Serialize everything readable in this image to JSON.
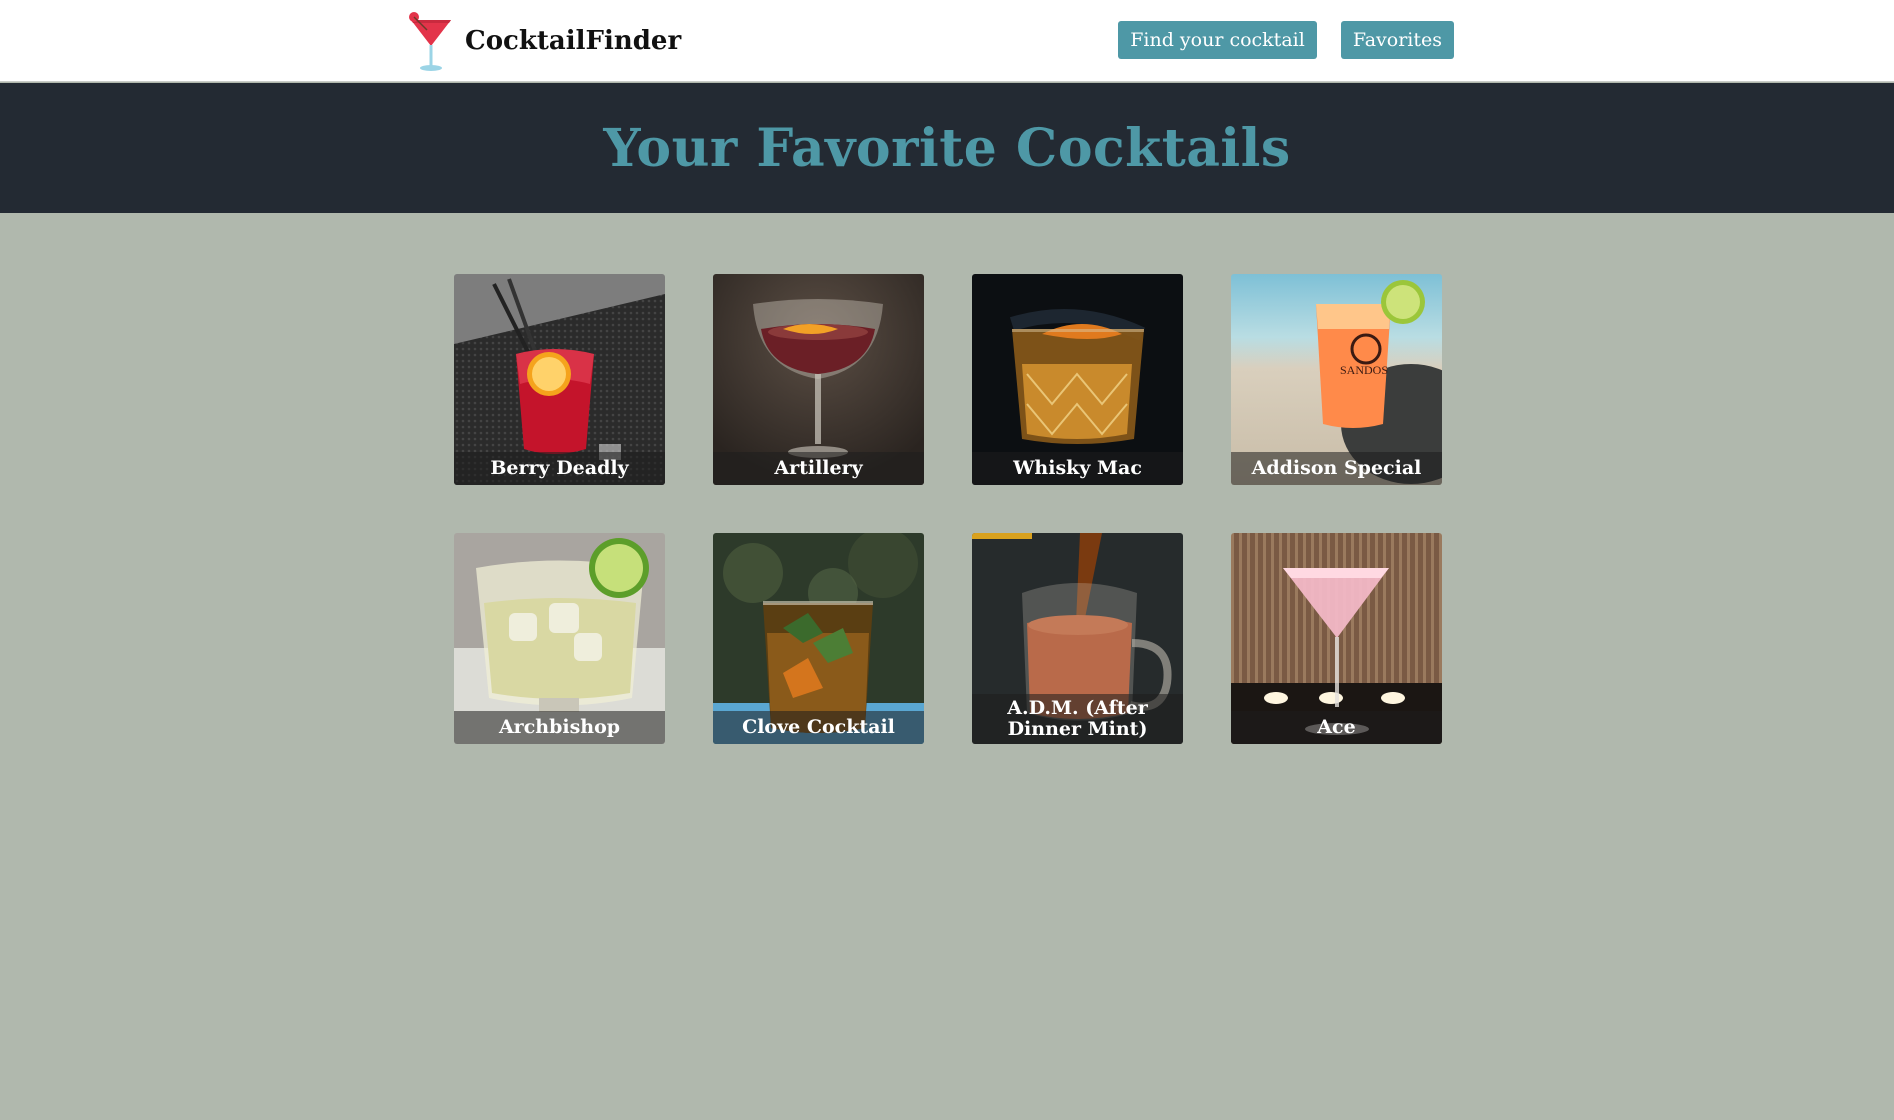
{
  "header": {
    "brand_name": "CocktailFinder",
    "logo_icon": "cocktail-glass-icon",
    "nav": {
      "find_label": "Find your cocktail",
      "favorites_label": "Favorites"
    }
  },
  "hero": {
    "title": "Your Favorite Cocktails"
  },
  "favorites": [
    {
      "name": "Berry Deadly"
    },
    {
      "name": "Artillery"
    },
    {
      "name": "Whisky Mac"
    },
    {
      "name": "Addison Special"
    },
    {
      "name": "Archbishop"
    },
    {
      "name": "Clove Cocktail"
    },
    {
      "name": "A.D.M. (After Dinner Mint)"
    },
    {
      "name": "Ace"
    }
  ],
  "colors": {
    "accent": "#4e98a6",
    "hero_bg": "#232a33",
    "page_bg": "#b0b8ad",
    "navbar_bg": "#ffffff"
  }
}
